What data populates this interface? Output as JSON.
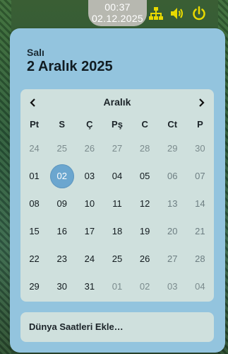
{
  "panel": {
    "clock_time": "00:37",
    "clock_date": "02.12.2025",
    "icons": [
      "network-icon",
      "volume-icon",
      "power-icon"
    ],
    "icon_color": "#e8d900"
  },
  "popup": {
    "day_name": "Salı",
    "full_date": "2 Aralık 2025",
    "month_title": "Aralık",
    "weekdays": [
      "Pt",
      "S",
      "Ç",
      "Pş",
      "C",
      "Ct",
      "P"
    ],
    "weeks": [
      [
        {
          "d": "24",
          "m": true
        },
        {
          "d": "25",
          "m": true
        },
        {
          "d": "26",
          "m": true
        },
        {
          "d": "27",
          "m": true
        },
        {
          "d": "28",
          "m": true
        },
        {
          "d": "29",
          "m": true
        },
        {
          "d": "30",
          "m": true
        }
      ],
      [
        {
          "d": "01"
        },
        {
          "d": "02",
          "sel": true
        },
        {
          "d": "03"
        },
        {
          "d": "04"
        },
        {
          "d": "05"
        },
        {
          "d": "06",
          "w": true
        },
        {
          "d": "07",
          "w": true
        }
      ],
      [
        {
          "d": "08"
        },
        {
          "d": "09"
        },
        {
          "d": "10"
        },
        {
          "d": "11"
        },
        {
          "d": "12"
        },
        {
          "d": "13",
          "w": true
        },
        {
          "d": "14",
          "w": true
        }
      ],
      [
        {
          "d": "15"
        },
        {
          "d": "16"
        },
        {
          "d": "17"
        },
        {
          "d": "18"
        },
        {
          "d": "19"
        },
        {
          "d": "20",
          "w": true
        },
        {
          "d": "21",
          "w": true
        }
      ],
      [
        {
          "d": "22"
        },
        {
          "d": "23"
        },
        {
          "d": "24"
        },
        {
          "d": "25"
        },
        {
          "d": "26"
        },
        {
          "d": "27",
          "w": true
        },
        {
          "d": "28",
          "w": true
        }
      ],
      [
        {
          "d": "29"
        },
        {
          "d": "30"
        },
        {
          "d": "31"
        },
        {
          "d": "01",
          "m": true
        },
        {
          "d": "02",
          "m": true
        },
        {
          "d": "03",
          "m": true
        },
        {
          "d": "04",
          "m": true
        }
      ]
    ],
    "world_clocks_label": "Dünya Saatleri Ekle…",
    "accent_color": "#6ba6cf"
  }
}
